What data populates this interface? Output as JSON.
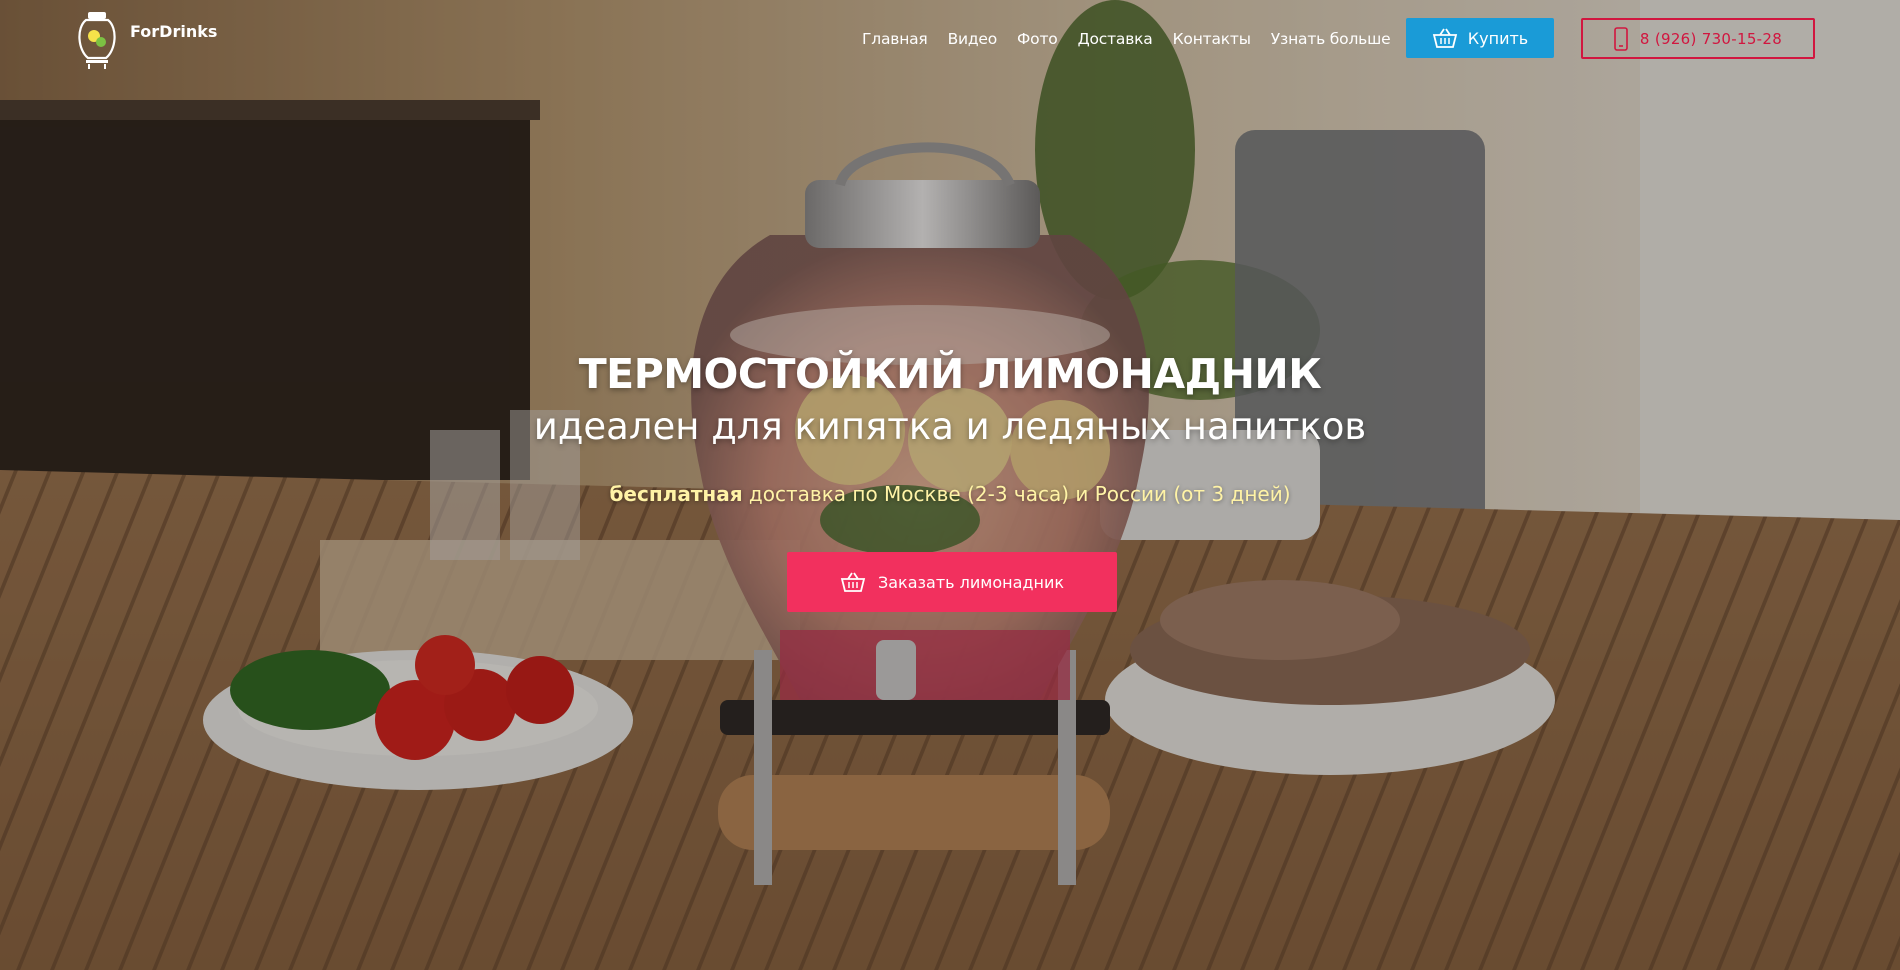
{
  "header": {
    "logo_text": "ForDrinks",
    "nav": [
      {
        "label": "Главная"
      },
      {
        "label": "Видео"
      },
      {
        "label": "Фото"
      },
      {
        "label": "Доставка"
      },
      {
        "label": "Контакты"
      },
      {
        "label": "Узнать больше"
      }
    ],
    "buy_label": "Купить",
    "phone": "8 (926) 730-15-28"
  },
  "hero": {
    "title": "ТЕРМОСТОЙКИЙ ЛИМОНАДНИК",
    "subtitle": "идеален для кипятка и ледяных напитков",
    "delivery_bold": "бесплатная",
    "delivery_rest": " доставка по Москве (2-3 часа) и России (от 3 дней)",
    "order_label": "Заказать лимонадник"
  },
  "colors": {
    "buy_button": "#1a9bd7",
    "phone_border": "#d1163f",
    "order_button": "#f2305e",
    "delivery_text": "#fff3a6"
  },
  "icons": {
    "buy": "basket-icon",
    "phone": "phone-icon",
    "order": "basket-icon"
  }
}
